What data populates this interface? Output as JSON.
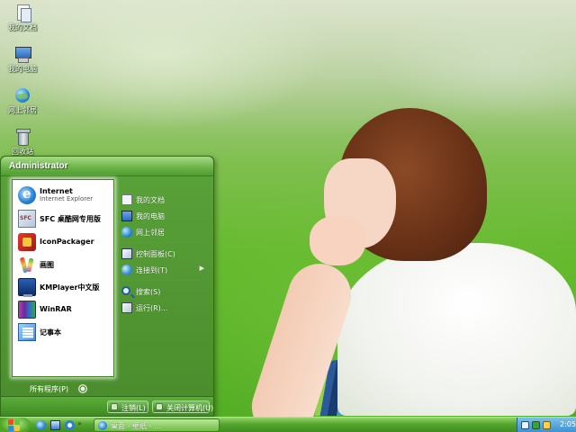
{
  "desktop": {
    "icons": [
      {
        "label": "我的文档",
        "icon": "my-documents-icon"
      },
      {
        "label": "我的电脑",
        "icon": "my-computer-icon"
      },
      {
        "label": "网上邻居",
        "icon": "network-places-icon"
      },
      {
        "label": "回收站",
        "icon": "recycle-bin-icon"
      }
    ]
  },
  "start_menu": {
    "user": "Administrator",
    "left_items": [
      {
        "title": "Internet",
        "subtitle": "Internet Explorer",
        "icon": "internet-explorer-icon"
      },
      {
        "title": "SFC 桌酷网专用版",
        "icon": "sfc-icon"
      },
      {
        "title": "IconPackager",
        "icon": "iconpackager-icon"
      },
      {
        "title": "画图",
        "icon": "paint-icon"
      },
      {
        "title": "KMPlayer中文版",
        "icon": "kmplayer-icon"
      },
      {
        "title": "WinRAR",
        "icon": "winrar-icon"
      },
      {
        "title": "记事本",
        "icon": "notepad-icon"
      }
    ],
    "right_items": [
      {
        "label": "我的文档",
        "icon": "documents-icon"
      },
      {
        "label": "我的电脑",
        "icon": "computer-icon"
      },
      {
        "label": "网上邻居",
        "icon": "network-icon"
      },
      {
        "label": "控制面板(C)",
        "icon": "control-panel-icon"
      },
      {
        "label": "连接到(T)",
        "icon": "connect-icon",
        "has_submenu": true
      },
      {
        "label": "搜索(S)",
        "icon": "search-icon"
      },
      {
        "label": "运行(R)...",
        "icon": "run-icon"
      }
    ],
    "all_programs": "所有程序(P)",
    "logoff": "注销(L)",
    "shutdown": "关闭计算机(U)"
  },
  "taskbar": {
    "quick_launch": [
      "ie-icon",
      "show-desktop-icon",
      "media-player-icon"
    ],
    "window_button": "桌面 - 壁纸 - ...",
    "clock": "2:05"
  },
  "colors": {
    "accent": "#4a8c2c",
    "taskbar": "#56a630",
    "tray": "#3b8ed0"
  }
}
